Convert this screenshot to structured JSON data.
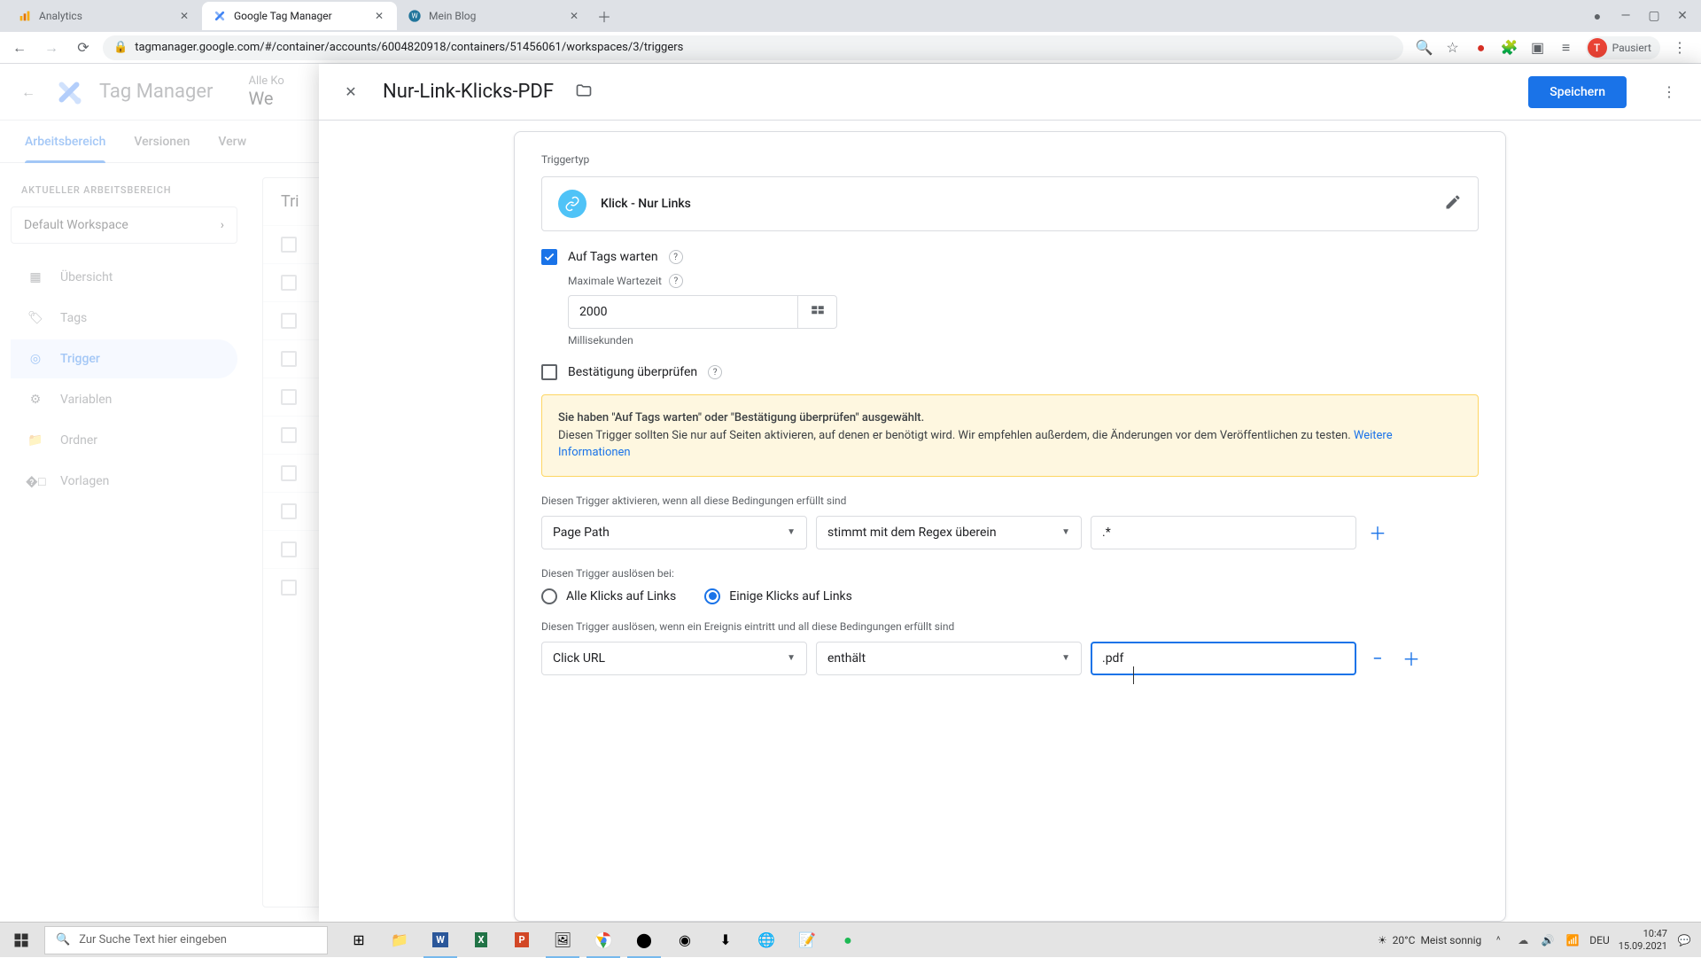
{
  "browser": {
    "tabs": [
      {
        "title": "Analytics",
        "favicon": "analytics"
      },
      {
        "title": "Google Tag Manager",
        "favicon": "gtm"
      },
      {
        "title": "Mein Blog",
        "favicon": "wordpress"
      }
    ],
    "url": "tagmanager.google.com/#/container/accounts/6004820918/containers/51456061/workspaces/3/triggers",
    "profile_status": "Pausiert",
    "profile_initial": "T"
  },
  "gtm": {
    "product": "Tag Manager",
    "breadcrumb_small": "Alle Ko",
    "breadcrumb_big": "We",
    "tabs": {
      "workspace": "Arbeitsbereich",
      "versions": "Versionen",
      "admin": "Verw"
    },
    "sidebar": {
      "ws_label": "AKTUELLER ARBEITSBEREICH",
      "ws_current": "Default Workspace",
      "items": [
        {
          "label": "Übersicht",
          "icon": "dashboard"
        },
        {
          "label": "Tags",
          "icon": "tag"
        },
        {
          "label": "Trigger",
          "icon": "target"
        },
        {
          "label": "Variablen",
          "icon": "tune"
        },
        {
          "label": "Ordner",
          "icon": "folder"
        },
        {
          "label": "Vorlagen",
          "icon": "template"
        }
      ]
    },
    "list_heading": "Tri"
  },
  "modal": {
    "title": "Nur-Link-Klicks-PDF",
    "save": "Speichern",
    "section_triggertype": "Triggertyp",
    "trigger_type_name": "Klick - Nur Links",
    "wait_for_tags": "Auf Tags warten",
    "max_wait_label": "Maximale Wartezeit",
    "max_wait_value": "2000",
    "max_wait_unit": "Millisekunden",
    "check_validation": "Bestätigung überprüfen",
    "info_bold": "Sie haben \"Auf Tags warten\" oder \"Bestätigung überprüfen\" ausgewählt.",
    "info_text": "Diesen Trigger sollten Sie nur auf Seiten aktivieren, auf denen er benötigt wird. Wir empfehlen außerdem, die Änderungen vor dem Veröffentlichen zu testen. ",
    "info_link": "Weitere Informationen",
    "enable_when": "Diesen Trigger aktivieren, wenn all diese Bedingungen erfüllt sind",
    "enable_var": "Page Path",
    "enable_op": "stimmt mit dem Regex überein",
    "enable_val": ".*",
    "fire_on_label": "Diesen Trigger auslösen bei:",
    "fire_all": "Alle Klicks auf Links",
    "fire_some": "Einige Klicks auf Links",
    "fire_conditions_label": "Diesen Trigger auslösen, wenn ein Ereignis eintritt und all diese Bedingungen erfüllt sind",
    "fire_var": "Click URL",
    "fire_op": "enthält",
    "fire_val": ".pdf"
  },
  "taskbar": {
    "search_placeholder": "Zur Suche Text hier eingeben",
    "weather_temp": "20°C",
    "weather_text": "Meist sonnig",
    "lang": "DEU",
    "time": "10:47",
    "date": "15.09.2021"
  }
}
